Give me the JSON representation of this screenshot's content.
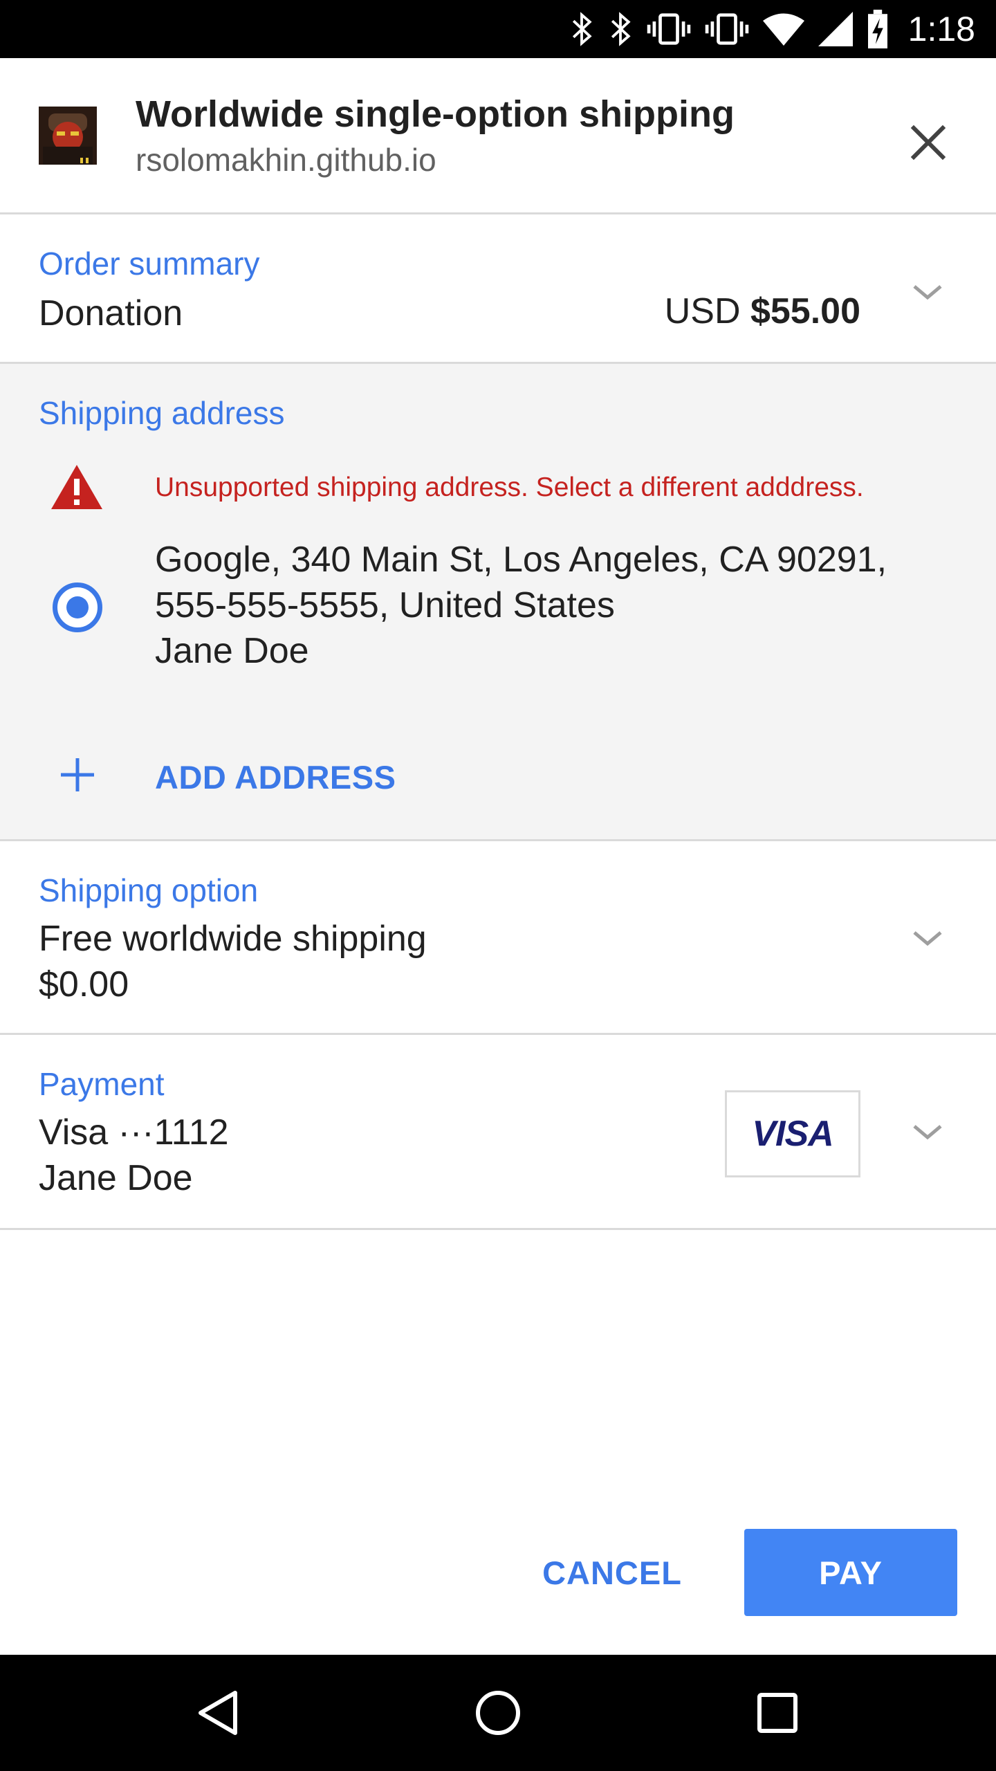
{
  "status_bar": {
    "time": "1:18",
    "icons": [
      "bluetooth-icon",
      "bluetooth-icon",
      "vibrate-icon",
      "vibrate-icon",
      "wifi-icon",
      "cell-signal-icon",
      "battery-charging-icon"
    ]
  },
  "header": {
    "title": "Worldwide single-option shipping",
    "origin": "rsolomakhin.github.io",
    "close_icon": "close-icon"
  },
  "order_summary": {
    "label": "Order summary",
    "item": "Donation",
    "currency": "USD",
    "total": "$55.00"
  },
  "shipping_address": {
    "label": "Shipping address",
    "warning": "Unsupported shipping address. Select a different adddress.",
    "selected_address": {
      "line1": "Google, 340 Main St, Los Angeles, CA 90291,",
      "line2": "555-555-5555, United States",
      "line3": "Jane Doe"
    },
    "add_label": "ADD ADDRESS"
  },
  "shipping_option": {
    "label": "Shipping option",
    "name": "Free worldwide shipping",
    "price": "$0.00"
  },
  "payment": {
    "label": "Payment",
    "card": "Visa ···1112",
    "holder": "Jane Doe",
    "card_brand": "VISA"
  },
  "actions": {
    "cancel": "CANCEL",
    "pay": "PAY"
  },
  "colors": {
    "accent": "#3b78e7",
    "pay_button": "#4285f4",
    "error": "#c5221f",
    "section_bg": "#f4f4f4",
    "divider": "#dadada"
  },
  "nav_bar": {
    "icons": [
      "back-icon",
      "home-icon",
      "recents-icon"
    ]
  }
}
